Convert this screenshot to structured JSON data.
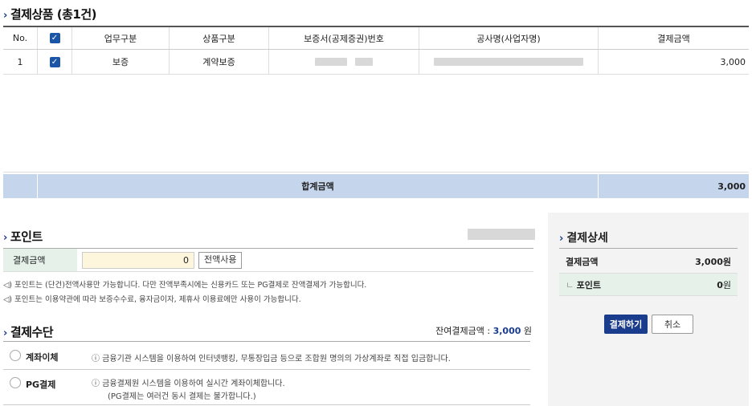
{
  "products": {
    "title": "결제상품 (총1건)",
    "columns": [
      "No.",
      "",
      "업무구분",
      "상품구분",
      "보증서(공제증권)번호",
      "공사명(사업자명)",
      "결제금액"
    ],
    "rows": [
      {
        "no": "1",
        "work": "보증",
        "type": "계약보증",
        "amount": "3,000"
      }
    ],
    "total_label": "합계금액",
    "total_amount": "3,000"
  },
  "points": {
    "title": "포인트",
    "field_label": "결제금액",
    "value": "0",
    "use_all_label": "전액사용",
    "notes": [
      "포인트는 (단건)전액사용만 가능합니다. 다만 잔액부족시에는 신용카드 또는 PG결제로 잔액결제가 가능합니다.",
      "포인트는 이용약관에 따라 보증수수료, 융자금이자, 제휴사 이용료에만 사용이 가능합니다."
    ]
  },
  "methods": {
    "title": "결제수단",
    "remain_label": "잔여결제금액 :",
    "remain_value": "3,000",
    "remain_unit": "원",
    "items": [
      {
        "label": "계좌이체",
        "desc": "ⓘ 금융기관 시스템을 이용하여 인터넷뱅킹, 무통장입금 등으로 조합원 명의의 가상계좌로 직접 입금합니다."
      },
      {
        "label": "PG결제",
        "desc": "ⓘ 금융결제원 시스템을 이용하여 실시간 계좌이체합니다.",
        "desc2": "(PG결제는 여러건 동시 결제는 불가합니다.)"
      }
    ]
  },
  "detail": {
    "title": "결제상세",
    "amount_label": "결제금액",
    "amount_value": "3,000원",
    "point_label": "포인트",
    "point_value": "0",
    "point_unit": "원",
    "pay_label": "결제하기",
    "cancel_label": "취소"
  }
}
